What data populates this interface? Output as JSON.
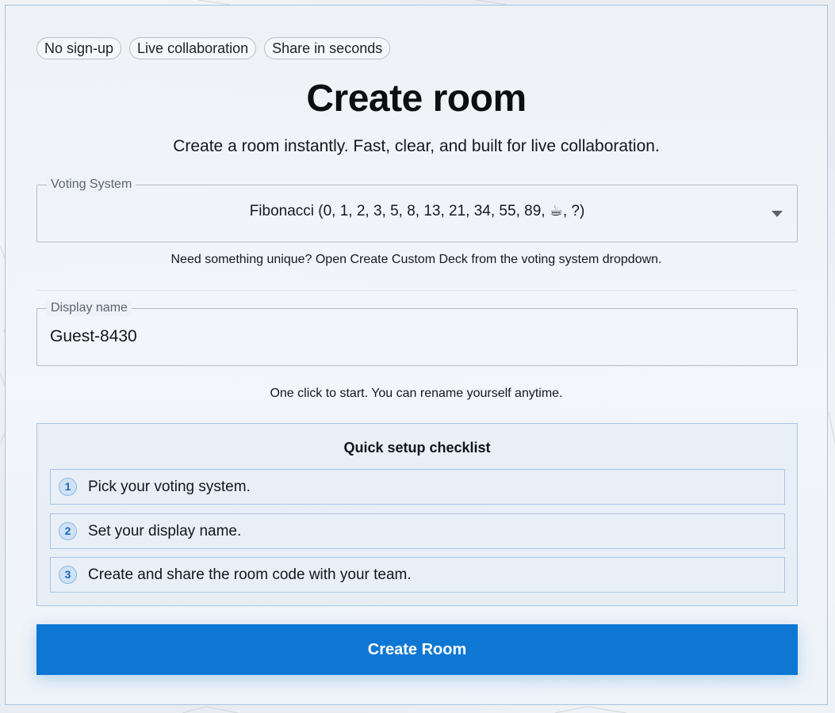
{
  "badges": [
    "No sign-up",
    "Live collaboration",
    "Share in seconds"
  ],
  "page": {
    "title": "Create room",
    "subtitle": "Create a room instantly. Fast, clear, and built for live collaboration."
  },
  "voting_system": {
    "label": "Voting System",
    "selected": "Fibonacci (0, 1, 2, 3, 5, 8, 13, 21, 34, 55, 89, ☕, ?)",
    "hint": "Need something unique? Open Create Custom Deck from the voting system dropdown."
  },
  "display_name": {
    "label": "Display name",
    "value": "Guest-8430",
    "hint": "One click to start. You can rename yourself anytime."
  },
  "checklist": {
    "title": "Quick setup checklist",
    "steps": [
      {
        "number": "1",
        "text": "Pick your voting system."
      },
      {
        "number": "2",
        "text": "Set your display name."
      },
      {
        "number": "3",
        "text": "Create and share the room code with your team."
      }
    ]
  },
  "actions": {
    "create_label": "Create Room"
  },
  "colors": {
    "primary": "#0e77d4",
    "card_border": "#a9c3de",
    "step_accent": "#1b69b8"
  },
  "icons": {
    "dropdown": "caret-down-icon"
  }
}
